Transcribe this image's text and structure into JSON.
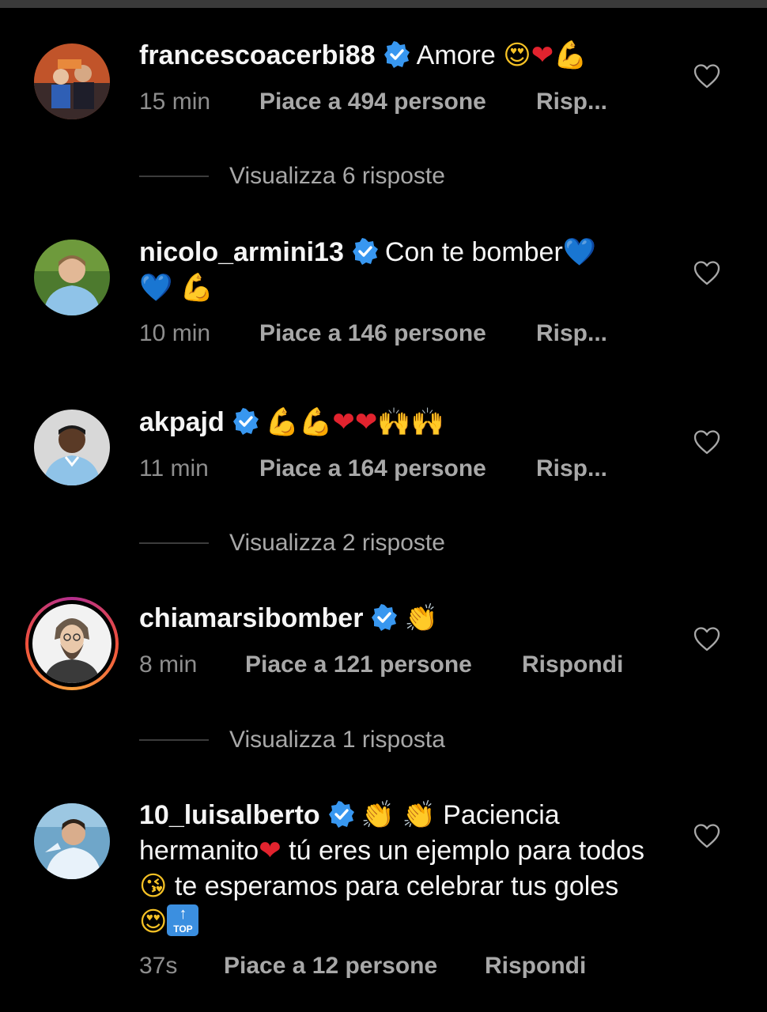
{
  "comments": [
    {
      "username": "francescoacerbi88",
      "text": "Amore",
      "emojis": [
        "😍",
        "❤",
        "💪"
      ],
      "time": "15 min",
      "likes": "Piace a 494 persone",
      "reply": "Risp..."
    },
    {
      "username": "nicolo_armini13",
      "text": "Con te bomber",
      "emojis": [
        "💙",
        "💙",
        "💪"
      ],
      "time": "10 min",
      "likes": "Piace a 146 persone",
      "reply": "Risp..."
    },
    {
      "username": "akpajd",
      "text": "",
      "emojis": [
        "💪",
        "💪",
        "❤",
        "❤",
        "🙌",
        "🙌"
      ],
      "time": "11 min",
      "likes": "Piace a 164 persone",
      "reply": "Risp..."
    },
    {
      "username": "chiamarsibomber",
      "text": "",
      "emojis": [
        "👏"
      ],
      "time": "8 min",
      "likes": "Piace a 121 persone",
      "reply": "Rispondi"
    },
    {
      "username": "10_luisalberto",
      "text_parts": [
        "Paciencia hermanito",
        "tú eres un ejemplo para todos",
        "te esperamos para celebrar tus goles"
      ],
      "emojis": [
        "👏",
        "👏",
        "❤",
        "😘",
        "😍",
        "🔝"
      ],
      "top_badge": "TOP",
      "time": "37s",
      "likes": "Piace a 12 persone",
      "reply": "Rispondi"
    }
  ],
  "view_replies": [
    "Visualizza 6 risposte",
    "Visualizza 2 risposte",
    "Visualizza 1 risposta"
  ],
  "colors": {
    "background": "#000000",
    "text": "#f5f5f5",
    "secondary_text": "#8e8e8e",
    "verified_badge": "#3897f0",
    "story_ring": "#f0503c"
  }
}
